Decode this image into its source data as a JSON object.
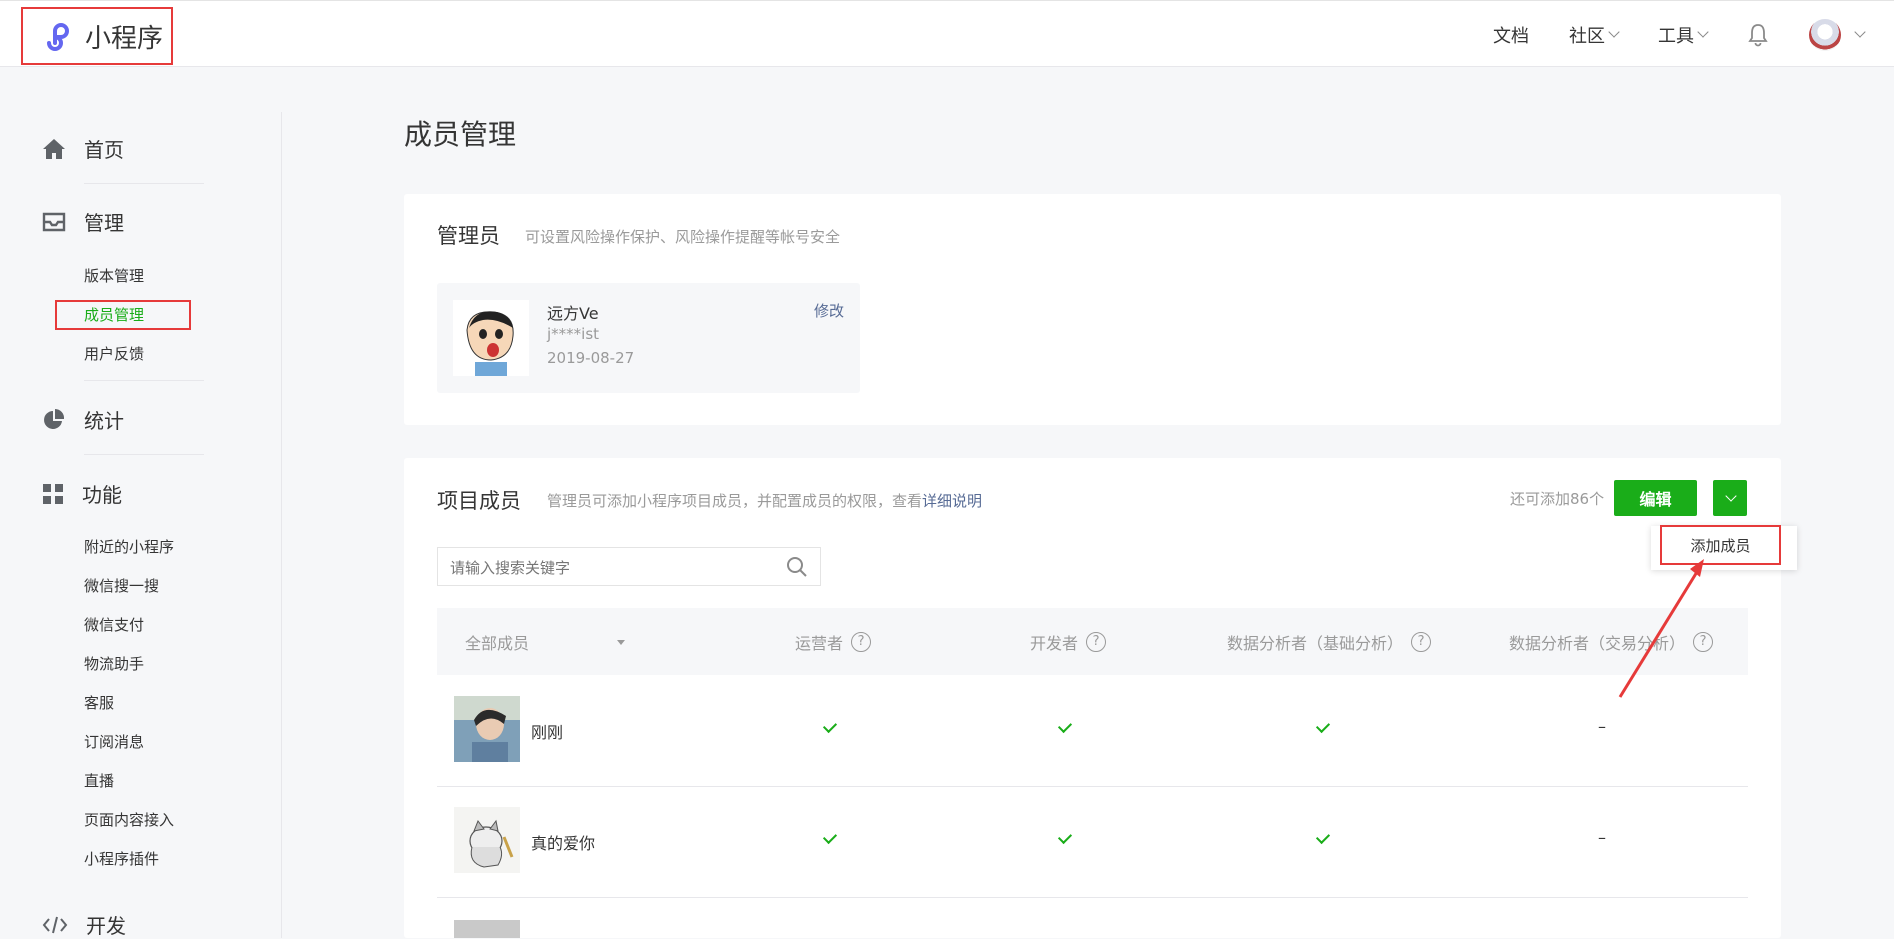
{
  "header": {
    "logo_text": "小程序",
    "nav": [
      {
        "label": "文档",
        "has_caret": false
      },
      {
        "label": "社区",
        "has_caret": true
      },
      {
        "label": "工具",
        "has_caret": true
      }
    ],
    "bell_icon": "bell-icon",
    "avatar_icon": "user-avatar"
  },
  "sidebar": {
    "home": "首页",
    "manage": "管理",
    "manage_items": [
      "版本管理",
      "成员管理",
      "用户反馈"
    ],
    "stats": "统计",
    "features": "功能",
    "feature_items": [
      "附近的小程序",
      "微信搜一搜",
      "微信支付",
      "物流助手",
      "客服",
      "订阅消息",
      "直播",
      "页面内容接入",
      "小程序插件"
    ],
    "dev": "开发"
  },
  "page": {
    "title": "成员管理"
  },
  "admin": {
    "title": "管理员",
    "desc": "可设置风险操作保护、风险操作提醒等帐号安全",
    "name": "远方Ve",
    "account": "j****ist",
    "date": "2019-08-27",
    "edit_label": "修改"
  },
  "members": {
    "title": "项目成员",
    "desc": "管理员可添加小程序项目成员，并配置成员的权限，查看",
    "desc_link": "详细说明",
    "remain": "还可添加86个",
    "edit_button": "编辑",
    "dropdown_item": "添加成员",
    "search_placeholder": "请输入搜索关键字",
    "columns": [
      "全部成员",
      "运营者",
      "开发者",
      "数据分析者（基础分析）",
      "数据分析者（交易分析）"
    ],
    "rows": [
      {
        "name": "刚刚",
        "operator": "✓",
        "developer": "✓",
        "data_basic": "✓",
        "data_trade": "–"
      },
      {
        "name": "真的爱你",
        "operator": "✓",
        "developer": "✓",
        "data_basic": "✓",
        "data_trade": "–"
      }
    ]
  },
  "colors": {
    "accent": "#1aad19",
    "link": "#576b95",
    "highlight": "#e63a3a"
  }
}
